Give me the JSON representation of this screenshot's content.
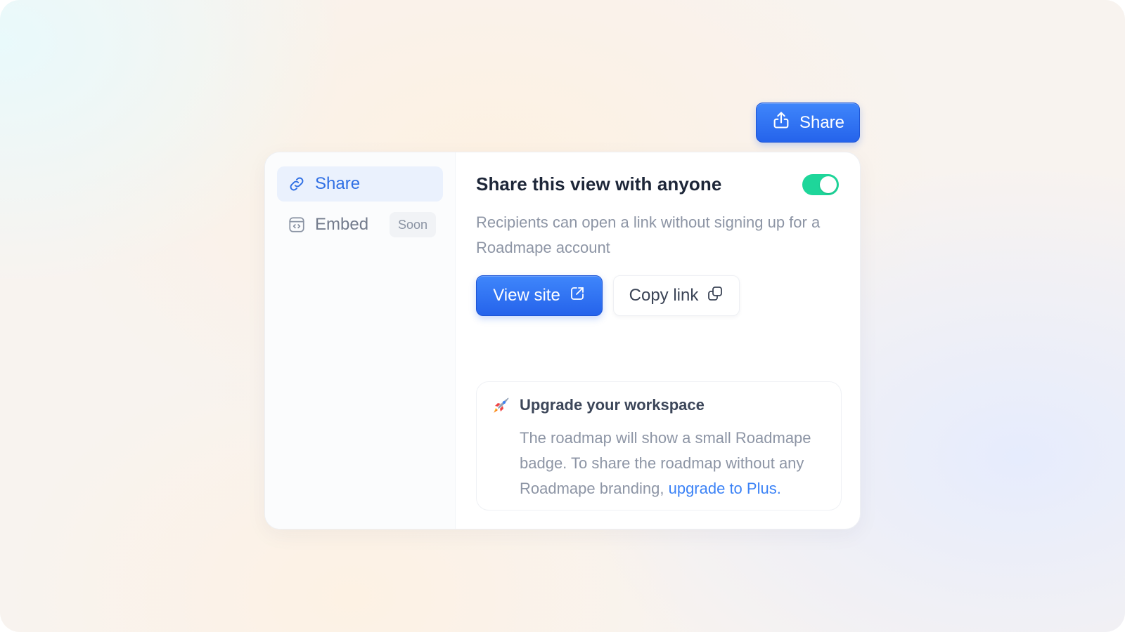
{
  "header": {
    "share_button_label": "Share"
  },
  "sidebar": {
    "items": [
      {
        "label": "Share",
        "icon": "link-icon",
        "active": true
      },
      {
        "label": "Embed",
        "icon": "code-window-icon",
        "badge": "Soon"
      }
    ]
  },
  "main": {
    "title": "Share this view with anyone",
    "toggle_on": true,
    "description": "Recipients can open a link without signing up for a Roadmape account",
    "view_site_label": "View site",
    "copy_link_label": "Copy link"
  },
  "upgrade": {
    "icon": "rocket-icon",
    "title": "Upgrade your workspace",
    "text": "The roadmap will show a small Roadmape badge. To share the roadmap without any Roadmape branding, ",
    "link_text": "upgrade to Plus."
  },
  "colors": {
    "accent": "#2563eb",
    "toggle": "#1ed69a",
    "link": "#3b82f6"
  }
}
